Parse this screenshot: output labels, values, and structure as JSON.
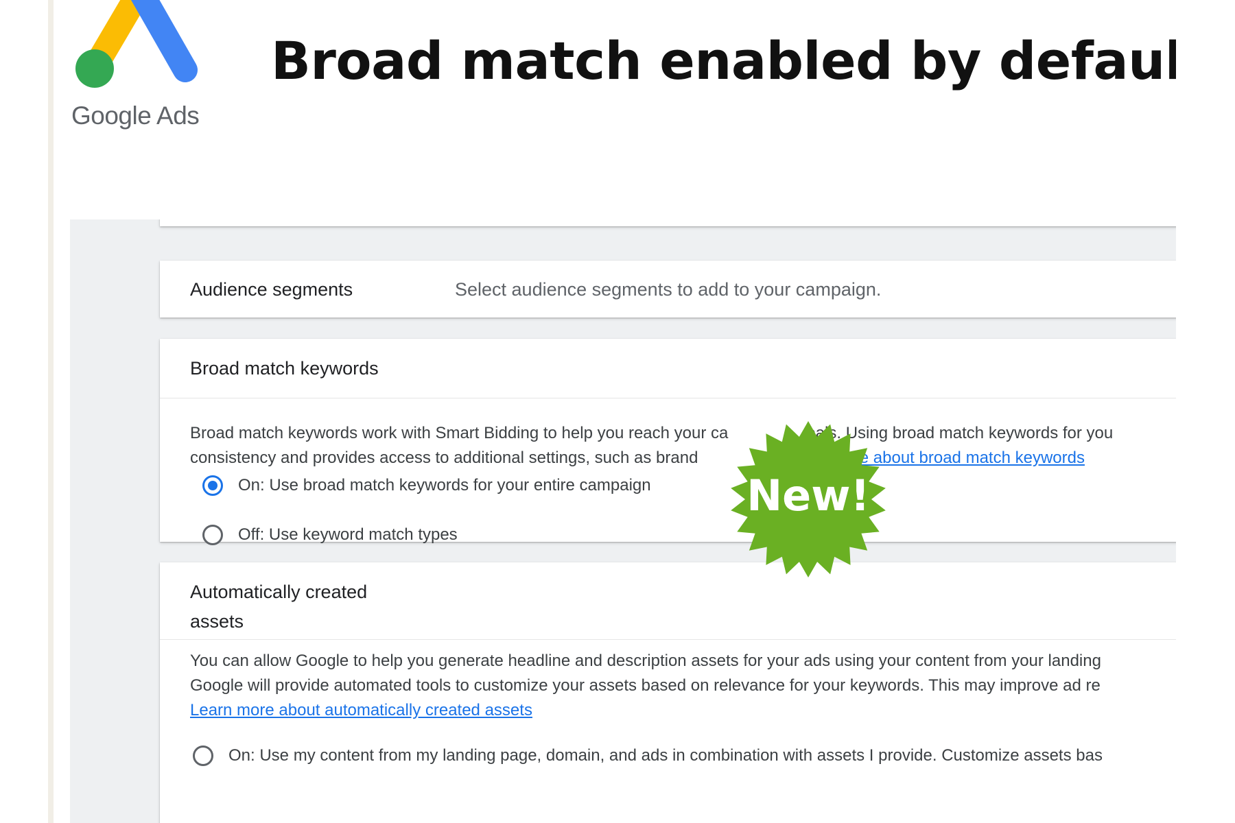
{
  "logo": {
    "caption": "Google Ads",
    "colors": {
      "yellow": "#fbbc04",
      "blue": "#4285f4",
      "green": "#34a853"
    }
  },
  "headline": "Broad match enabled by default!",
  "audience": {
    "title": "Audience segments",
    "description": "Select audience segments to add to your campaign."
  },
  "broad_match": {
    "title": "Broad match keywords",
    "description_line1_a": "Broad match keywords work with Smart Bidding to help you reach your ca",
    "description_line1_b": "oals. Using broad match keywords for you",
    "description_line2_a": "consistency and provides access to additional settings, such as brand",
    "description_line2_link": "rn more about broad match keywords",
    "options": [
      {
        "label": "On: Use broad match keywords for your entire campaign",
        "selected": true
      },
      {
        "label": "Off: Use keyword match types",
        "selected": false
      }
    ]
  },
  "auto_assets": {
    "title_line1": "Automatically created",
    "title_line2": "assets",
    "description_line1": "You can allow Google to help you generate headline and description assets for your ads using your content from your landing",
    "description_line2": "Google will provide automated tools to customize your assets based on relevance for your keywords. This may improve ad re",
    "link": "Learn more about automatically created assets",
    "option": "On: Use my content from my landing page, domain, and ads in combination with assets I provide. Customize assets bas"
  },
  "badge": {
    "text": "New!",
    "color": "#6ab023"
  },
  "accent_color": "#1a73e8"
}
